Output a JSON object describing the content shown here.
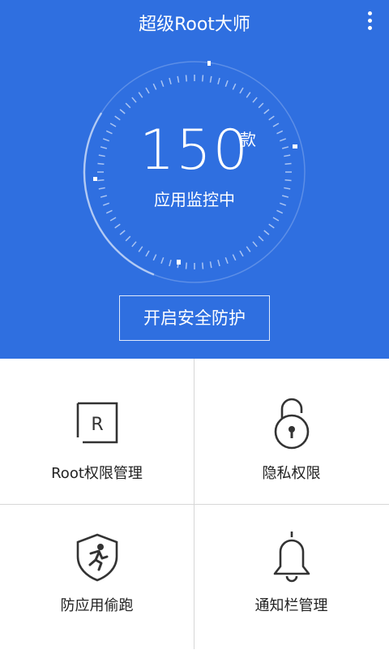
{
  "header": {
    "title": "超级Root大师",
    "menu_icon": "more-vert-icon"
  },
  "monitor": {
    "count": "150",
    "unit": "款",
    "status": "应用监控中",
    "progress": 0.28
  },
  "actions": {
    "protect_label": "开启安全防护"
  },
  "features": [
    {
      "label": "Root权限管理",
      "icon": "root-r-icon"
    },
    {
      "label": "隐私权限",
      "icon": "padlock-icon"
    },
    {
      "label": "防应用偷跑",
      "icon": "shield-runner-icon"
    },
    {
      "label": "通知栏管理",
      "icon": "bell-icon"
    }
  ],
  "colors": {
    "accent": "#2f6fe0",
    "text_dark": "#222222",
    "divider": "#d7d7d7"
  }
}
